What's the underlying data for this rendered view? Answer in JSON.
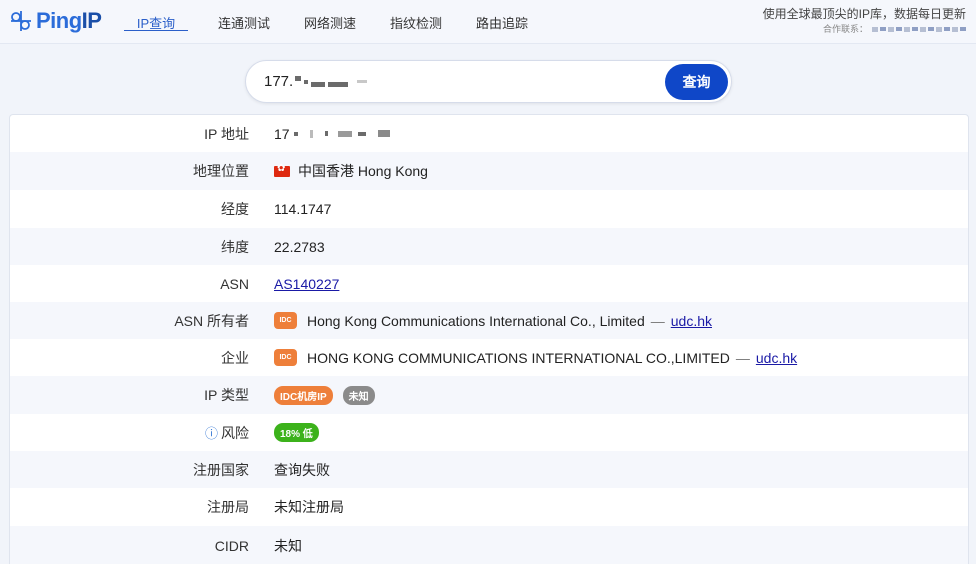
{
  "header": {
    "logo_text": "Ping",
    "logo_ip": "IP",
    "nav": [
      "IP查询",
      "连通测试",
      "网络测速",
      "指纹检测",
      "路由追踪"
    ],
    "tagline": "使用全球最顶尖的IP库，数据每日更新",
    "contact_label": "合作联系："
  },
  "search": {
    "value": "177.",
    "button": "查询"
  },
  "rows": [
    {
      "label": "IP 地址",
      "value": "17"
    },
    {
      "label": "地理位置",
      "value": "中国香港 Hong Kong"
    },
    {
      "label": "经度",
      "value": "114.1747"
    },
    {
      "label": "纬度",
      "value": "22.2783"
    },
    {
      "label": "ASN",
      "value": "AS140227"
    },
    {
      "label": "ASN 所有者",
      "tag": "IDC",
      "value": "Hong Kong Communications International Co., Limited",
      "sep": "—",
      "link": "udc.hk"
    },
    {
      "label": "企业",
      "tag": "IDC",
      "value": "HONG KONG COMMUNICATIONS INTERNATIONAL CO.,LIMITED",
      "sep": "—",
      "link": "udc.hk"
    },
    {
      "label": "IP 类型",
      "badges": [
        "IDC机房IP",
        "未知"
      ]
    },
    {
      "label": "风险",
      "info_icon": "ⓘ",
      "badge": "18% 低"
    },
    {
      "label": "注册国家",
      "value": "查询失败"
    },
    {
      "label": "注册局",
      "value": "未知注册局"
    },
    {
      "label": "CIDR",
      "value": "未知"
    }
  ],
  "colors": {
    "accent": "#0f47c8",
    "orange": "#ee7f3a",
    "gray": "#8b8b8b",
    "green": "#3cb21b"
  }
}
